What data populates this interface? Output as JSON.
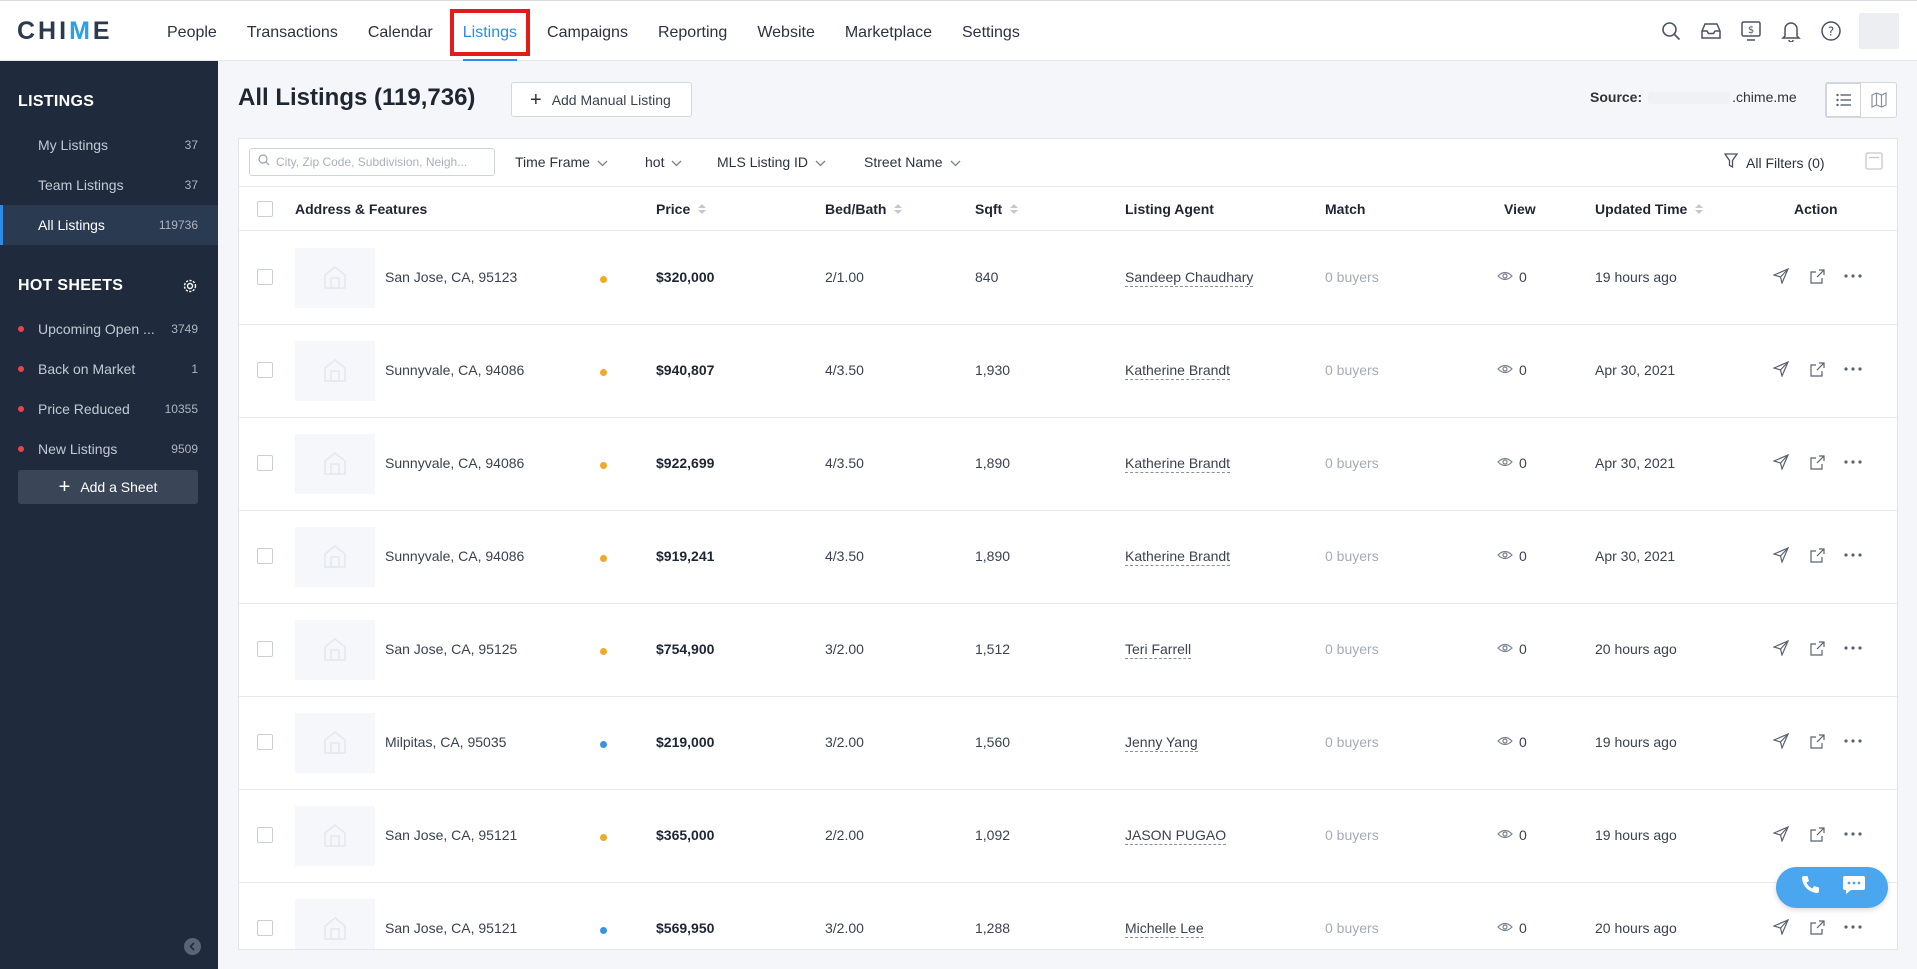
{
  "app": {
    "logo_left": "CHI",
    "logo_accent": "M",
    "logo_right": "E"
  },
  "nav": {
    "items": [
      "People",
      "Transactions",
      "Calendar",
      "Listings",
      "Campaigns",
      "Reporting",
      "Website",
      "Marketplace",
      "Settings"
    ],
    "active": "Listings"
  },
  "top_icons": [
    "search-icon",
    "inbox-icon",
    "dollar-monitor-icon",
    "bell-icon",
    "help-icon"
  ],
  "sidebar": {
    "listings_heading": "LISTINGS",
    "listings": [
      {
        "label": "My Listings",
        "count": "37"
      },
      {
        "label": "Team Listings",
        "count": "37"
      },
      {
        "label": "All Listings",
        "count": "119736"
      }
    ],
    "hot_heading": "HOT SHEETS",
    "hot_sheets": [
      {
        "label": "Upcoming Open ...",
        "count": "3749"
      },
      {
        "label": "Back on Market",
        "count": "1"
      },
      {
        "label": "Price Reduced",
        "count": "10355"
      },
      {
        "label": "New Listings",
        "count": "9509"
      }
    ],
    "add_sheet": "Add a Sheet"
  },
  "main": {
    "title": "All Listings (119,736)",
    "add_manual": "Add Manual Listing",
    "source_label": "Source:",
    "source_domain": ".chime.me"
  },
  "filters": {
    "search_placeholder": "City, Zip Code, Subdivision, Neigh...",
    "time_frame": "Time Frame",
    "hot": "hot",
    "mls": "MLS Listing ID",
    "street": "Street Name",
    "all_filters": "All Filters (0)"
  },
  "table": {
    "headers": {
      "address": "Address & Features",
      "price": "Price",
      "bedbath": "Bed/Bath",
      "sqft": "Sqft",
      "agent": "Listing Agent",
      "match": "Match",
      "view": "View",
      "updated": "Updated Time",
      "action": "Action"
    },
    "rows": [
      {
        "address": "San Jose, CA, 95123",
        "dot": "#f0a928",
        "price": "$320,000",
        "bedbath": "2/1.00",
        "sqft": "840",
        "agent": "Sandeep Chaudhary",
        "match": "0 buyers",
        "views": "0",
        "updated": "19 hours ago"
      },
      {
        "address": "Sunnyvale, CA, 94086",
        "dot": "#f0a928",
        "price": "$940,807",
        "bedbath": "4/3.50",
        "sqft": "1,930",
        "agent": "Katherine Brandt",
        "match": "0 buyers",
        "views": "0",
        "updated": "Apr 30, 2021"
      },
      {
        "address": "Sunnyvale, CA, 94086",
        "dot": "#f0a928",
        "price": "$922,699",
        "bedbath": "4/3.50",
        "sqft": "1,890",
        "agent": "Katherine Brandt",
        "match": "0 buyers",
        "views": "0",
        "updated": "Apr 30, 2021"
      },
      {
        "address": "Sunnyvale, CA, 94086",
        "dot": "#f0a928",
        "price": "$919,241",
        "bedbath": "4/3.50",
        "sqft": "1,890",
        "agent": "Katherine Brandt",
        "match": "0 buyers",
        "views": "0",
        "updated": "Apr 30, 2021"
      },
      {
        "address": "San Jose, CA, 95125",
        "dot": "#f0a928",
        "price": "$754,900",
        "bedbath": "3/2.00",
        "sqft": "1,512",
        "agent": "Teri Farrell",
        "match": "0 buyers",
        "views": "0",
        "updated": "20 hours ago"
      },
      {
        "address": "Milpitas, CA, 95035",
        "dot": "#3a93e0",
        "price": "$219,000",
        "bedbath": "3/2.00",
        "sqft": "1,560",
        "agent": "Jenny Yang",
        "match": "0 buyers",
        "views": "0",
        "updated": "19 hours ago"
      },
      {
        "address": "San Jose, CA, 95121",
        "dot": "#f0a928",
        "price": "$365,000",
        "bedbath": "2/2.00",
        "sqft": "1,092",
        "agent": "JASON PUGAO",
        "match": "0 buyers",
        "views": "0",
        "updated": "19 hours ago"
      },
      {
        "address": "San Jose, CA, 95121",
        "dot": "#3a93e0",
        "price": "$569,950",
        "bedbath": "3/2.00",
        "sqft": "1,288",
        "agent": "Michelle Lee",
        "match": "0 buyers",
        "views": "0",
        "updated": "20 hours ago"
      }
    ]
  },
  "colors": {
    "accent": "#2b8ce8",
    "sidebar_bg": "#1f2b3c",
    "highlight_box": "#e31b1b",
    "dot_yellow": "#f0a928",
    "dot_blue": "#3a93e0"
  }
}
